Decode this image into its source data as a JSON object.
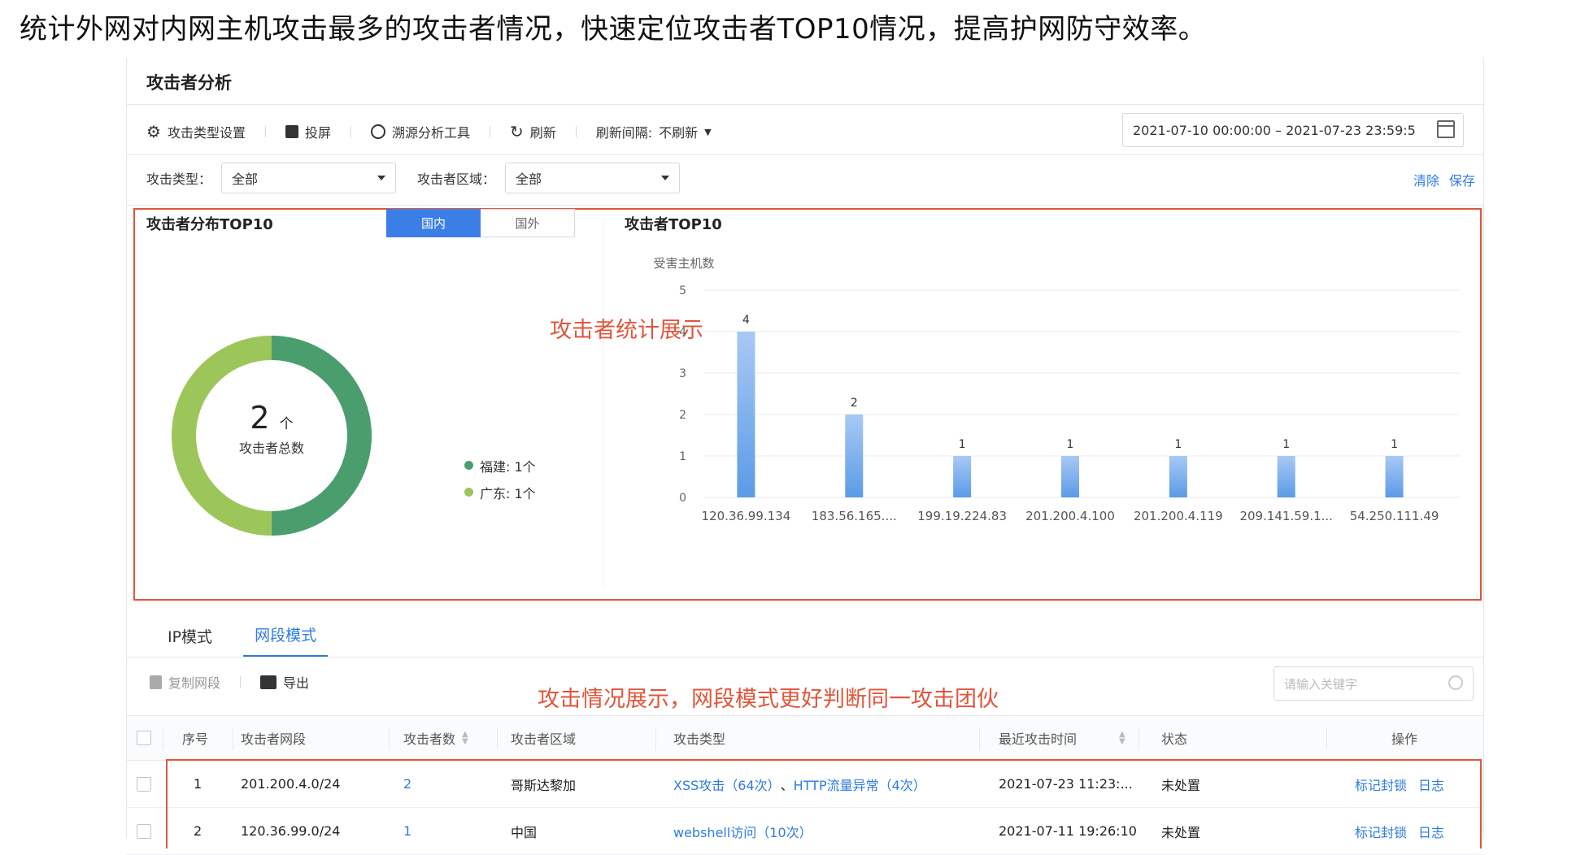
{
  "caption": "统计外网对内网主机攻击最多的攻击者情况，快速定位攻击者TOP10情况，提高护网防守效率。",
  "panel": {
    "title": "攻击者分析"
  },
  "toolbar": {
    "attack_type_settings": "攻击类型设置",
    "cast_screen": "投屏",
    "trace_tool": "溯源分析工具",
    "refresh": "刷新",
    "refresh_interval_label": "刷新间隔:",
    "refresh_interval_value": "不刷新",
    "date_range": "2021-07-10 00:00:00 – 2021-07-23 23:59:5"
  },
  "filters": {
    "attack_type_label": "攻击类型：",
    "attack_type_value": "全部",
    "region_label": "攻击者区域：",
    "region_value": "全部",
    "clear": "清除",
    "save": "保存"
  },
  "distribution": {
    "title": "攻击者分布TOP10",
    "tab_domestic": "国内",
    "tab_foreign": "国外",
    "total_value": "2",
    "total_unit": "个",
    "total_label": "攻击者总数",
    "legend": [
      {
        "label": "福建: 1个",
        "color": "#4a9e6e",
        "value": 1
      },
      {
        "label": "广东: 1个",
        "color": "#9cc65a",
        "value": 1
      }
    ]
  },
  "annotations": {
    "stats": "攻击者统计展示",
    "table": "攻击情况展示，网段模式更好判断同一攻击团伙"
  },
  "top10": {
    "title": "攻击者TOP10"
  },
  "chart_data": {
    "type": "bar",
    "title": "攻击者TOP10",
    "ylabel": "受害主机数",
    "ylim": [
      0,
      5
    ],
    "yticks": [
      "0",
      "1",
      "2",
      "3",
      "4",
      "5"
    ],
    "categories": [
      "120.36.99.134",
      "183.56.165....",
      "199.19.224.83",
      "201.200.4.100",
      "201.200.4.119",
      "209.141.59.1...",
      "54.250.111.49"
    ],
    "values": [
      4,
      2,
      1,
      1,
      1,
      1,
      1
    ],
    "grid": true,
    "bar_color": "#5b9be8"
  },
  "tabs": {
    "ip_mode": "IP模式",
    "segment_mode": "网段模式"
  },
  "table_tools": {
    "copy_segment": "复制网段",
    "export": "导出",
    "search_placeholder": "请输入关键字"
  },
  "table": {
    "headers": [
      "序号",
      "攻击者网段",
      "攻击者数",
      "攻击者区域",
      "攻击类型",
      "最近攻击时间",
      "状态",
      "操作"
    ],
    "rows": [
      {
        "index": "1",
        "segment": "201.200.4.0/24",
        "count": "2",
        "region": "哥斯达黎加",
        "type_a": "XSS攻击（64次）",
        "sep": "、",
        "type_b": "HTTP流量异常（4次）",
        "time": "2021-07-23 11:23:...",
        "status": "未处置",
        "action_block": "标记封锁",
        "action_log": "日志"
      },
      {
        "index": "2",
        "segment": "120.36.99.0/24",
        "count": "1",
        "region": "中国",
        "type_a": "webshell访问（10次）",
        "sep": "",
        "type_b": "",
        "time": "2021-07-11 19:26:10",
        "status": "未处置",
        "action_block": "标记封锁",
        "action_log": "日志"
      }
    ]
  }
}
